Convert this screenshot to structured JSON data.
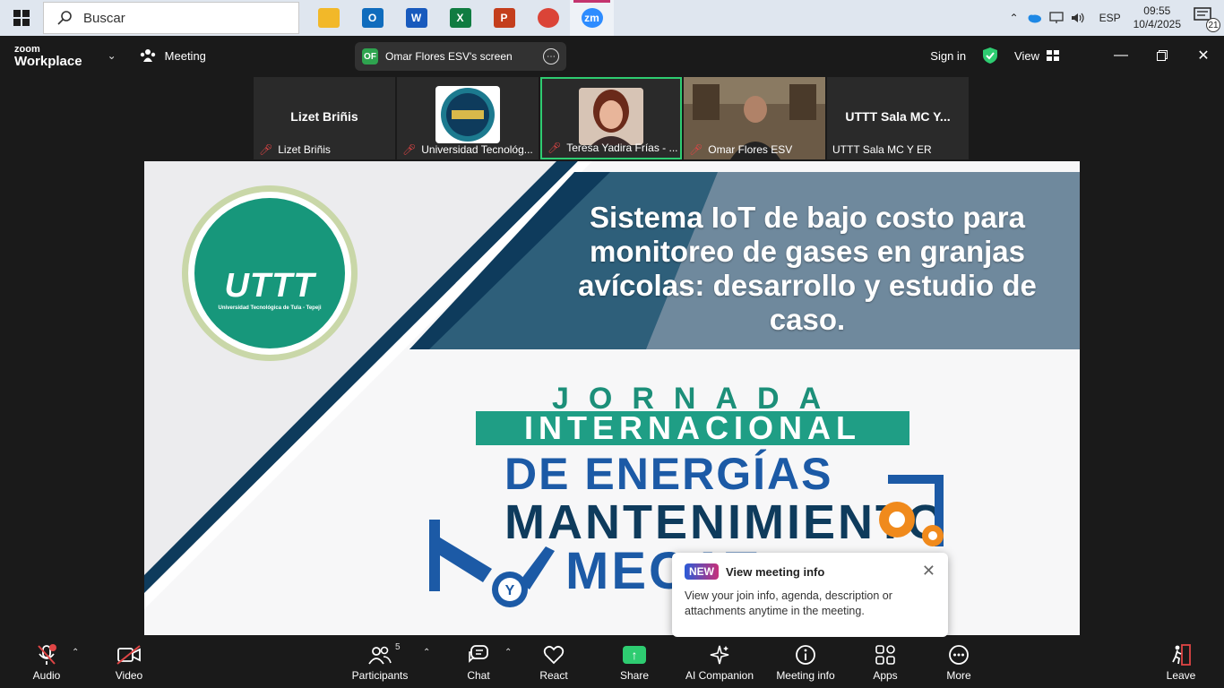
{
  "taskbar": {
    "search_placeholder": "Buscar",
    "apps": [
      {
        "name": "file-explorer-icon",
        "label": "",
        "color": "#f2b829"
      },
      {
        "name": "outlook-icon",
        "label": "O",
        "color": "#0f6cbd"
      },
      {
        "name": "word-icon",
        "label": "W",
        "color": "#185abd"
      },
      {
        "name": "excel-icon",
        "label": "X",
        "color": "#107c41"
      },
      {
        "name": "powerpoint-icon",
        "label": "P",
        "color": "#c43e1c"
      },
      {
        "name": "chrome-icon",
        "label": "",
        "color": "#db4437"
      },
      {
        "name": "zoom-app-icon",
        "label": "zm",
        "color": "#2d8cff"
      }
    ],
    "language": "ESP",
    "time": "09:55",
    "date": "10/4/2025",
    "notification_count": "21"
  },
  "zoom_header": {
    "logo_line1": "zoom",
    "logo_line2": "Workplace",
    "meeting_label": "Meeting",
    "screen_initials": "OF",
    "screen_label": "Omar Flores ESV's screen",
    "sign_in": "Sign in",
    "view_label": "View"
  },
  "participants": [
    {
      "big_name": "Lizet Briñis",
      "name": "Lizet Briñis",
      "muted": true,
      "has_video": false
    },
    {
      "big_name": "",
      "name": "Universidad Tecnológ...",
      "muted": true,
      "has_video": true
    },
    {
      "big_name": "",
      "name": "Teresa Yadira Frías - ...",
      "muted": true,
      "has_video": true,
      "active": true
    },
    {
      "big_name": "",
      "name": "Omar Flores ESV",
      "muted": true,
      "has_video": true
    },
    {
      "big_name": "UTTT Sala MC Y...",
      "name": "UTTT Sala MC Y ER",
      "muted": false,
      "has_video": false
    }
  ],
  "slide": {
    "logo_text": "UTTT",
    "logo_subtext": "Universidad Tecnológica de Tula - Tepeji",
    "title": "Sistema IoT de bajo costo para monitoreo de gases en granjas avícolas: desarrollo y estudio de caso.",
    "jornada": "JORNADA",
    "internacional": "INTERNACIONAL",
    "energias": "DE ENERGÍAS",
    "mantenimiento": "MANTENIMIENTO",
    "mecatronica": "MECAT"
  },
  "popup": {
    "badge": "NEW",
    "title": "View meeting info",
    "body": "View your join info, agenda, description or attachments anytime in the meeting."
  },
  "toolbar": {
    "audio": "Audio",
    "video": "Video",
    "participants": "Participants",
    "participants_count": "5",
    "chat": "Chat",
    "react": "React",
    "share": "Share",
    "ai_companion": "AI Companion",
    "meeting_info": "Meeting info",
    "apps": "Apps",
    "more": "More",
    "leave": "Leave"
  },
  "colors": {
    "zoom_bg": "#1a1a1a",
    "accent_green": "#2ecc71",
    "teal": "#1f9e85",
    "navy": "#0e3b5c"
  }
}
